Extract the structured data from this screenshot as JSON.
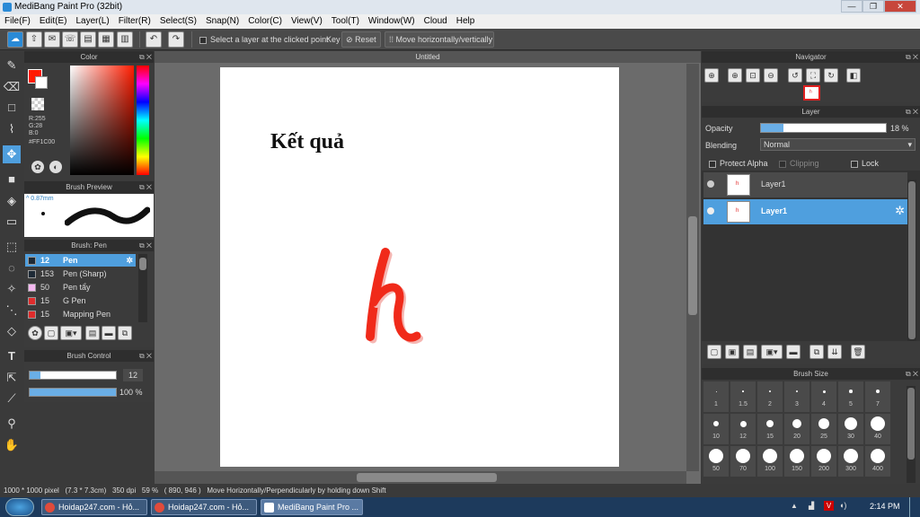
{
  "window": {
    "title": "MediBang Paint Pro (32bit)"
  },
  "menu": [
    "File(F)",
    "Edit(E)",
    "Layer(L)",
    "Filter(R)",
    "Select(S)",
    "Snap(N)",
    "Color(C)",
    "View(V)",
    "Tool(T)",
    "Window(W)",
    "Cloud",
    "Help"
  ],
  "toolbar": {
    "select_layer_label": "Select a layer at the clicked point",
    "key_label": "Key",
    "reset_label": "Reset",
    "move_label": "Move horizontally/vertically"
  },
  "color_panel": {
    "title": "Color",
    "r": "R:255",
    "g": "G:28",
    "b": "B:0",
    "hex": "#FF1C00",
    "fg_color": "#ff1c00"
  },
  "brush_preview": {
    "title": "Brush Preview",
    "size": "0.87mm"
  },
  "brush_panel": {
    "title": "Brush: Pen",
    "items": [
      {
        "size": "12",
        "name": "Pen",
        "color": "#1e2a36"
      },
      {
        "size": "153",
        "name": "Pen (Sharp)",
        "color": "#1e2a36"
      },
      {
        "size": "50",
        "name": "Pen tẩy",
        "color": "#f4b8f0"
      },
      {
        "size": "15",
        "name": "G Pen",
        "color": "#e02c2c"
      },
      {
        "size": "15",
        "name": "Mapping Pen",
        "color": "#e02c2c"
      }
    ]
  },
  "brush_control": {
    "title": "Brush Control",
    "size": "12",
    "opacity": "100 %",
    "size_fraction": 0.12,
    "opacity_fraction": 1.0
  },
  "canvas": {
    "tab_title": "Untitled",
    "heading": "Kết quả",
    "stroke_color": "#f02a1a"
  },
  "navigator": {
    "title": "Navigator"
  },
  "layer_panel": {
    "title": "Layer",
    "opacity_label": "Opacity",
    "opacity_value": "18 %",
    "opacity_fraction": 0.18,
    "blending_label": "Blending",
    "blending_value": "Normal",
    "protect_alpha": "Protect Alpha",
    "clipping": "Clipping",
    "lock": "Lock",
    "layers": [
      "Layer1",
      "Layer1"
    ]
  },
  "brush_size": {
    "title": "Brush Size",
    "sizes": [
      "1",
      "1.5",
      "2",
      "3",
      "4",
      "5",
      "7",
      "10",
      "12",
      "15",
      "20",
      "25",
      "30",
      "40",
      "50",
      "70",
      "100",
      "150",
      "200",
      "300",
      "400"
    ]
  },
  "status": {
    "dimensions": "1000 * 1000 pixel",
    "physical": "(7.3 * 7.3cm)",
    "dpi": "350 dpi",
    "zoom": "59 %",
    "coords": "( 890, 946 )",
    "hint": "Move Horizontally/Perpendicularly by holding down Shift"
  },
  "taskbar": {
    "items": [
      "Hoidap247.com - Hỏ...",
      "Hoidap247.com - Hỏ...",
      "MediBang Paint Pro ..."
    ],
    "time": "2:14 PM"
  }
}
